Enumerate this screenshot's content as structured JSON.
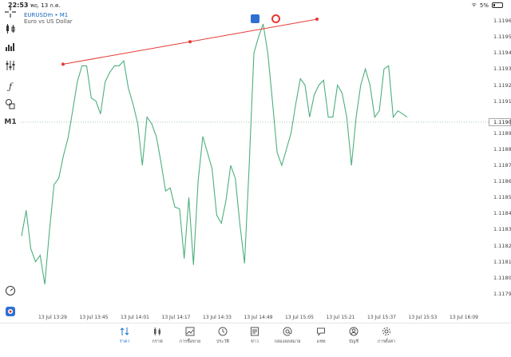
{
  "status": {
    "time": "22:53",
    "date": "พฤ. 13 ก.ค.",
    "battery": "5%"
  },
  "chart": {
    "symbol": "EURUSDm • M1",
    "description": "Euro vs US Dollar",
    "timeframe": "M1",
    "current_price": "1.11900",
    "line_color": "#4caf7d",
    "trendline_color": "#e53935",
    "price_labels": [
      "1.11960",
      "1.11950",
      "1.11940",
      "1.11930",
      "1.11920",
      "1.11910",
      "1.11890",
      "1.11880",
      "1.11870",
      "1.11860",
      "1.11850",
      "1.11840",
      "1.11830",
      "1.11820",
      "1.11810",
      "1.11800",
      "1.11790"
    ],
    "time_labels": [
      "13 Jul 13:29",
      "13 Jul 13:45",
      "13 Jul 14:01",
      "13 Jul 14:17",
      "13 Jul 14:33",
      "13 Jul 14:49",
      "13 Jul 15:05",
      "13 Jul 15:21",
      "13 Jul 15:37",
      "13 Jul 15:53",
      "13 Jul 16:09"
    ]
  },
  "chart_data": {
    "type": "line",
    "series": [
      {
        "values": [
          1.11826,
          1.11842,
          1.11818,
          1.1181,
          1.11814,
          1.11796,
          1.11829,
          1.11858,
          1.11862,
          1.11876,
          1.11887,
          1.11904,
          1.11922,
          1.11932,
          1.11932,
          1.11912,
          1.1191,
          1.11902,
          1.11922,
          1.11928,
          1.11932,
          1.11932,
          1.11935,
          1.11918,
          1.11908,
          1.11896,
          1.1187,
          1.119,
          1.11896,
          1.11888,
          1.11872,
          1.11854,
          1.11856,
          1.11844,
          1.11843,
          1.11812,
          1.1185,
          1.11808,
          1.1186,
          1.11888,
          1.11878,
          1.11868,
          1.11839,
          1.11834,
          1.11848,
          1.1187,
          1.11862,
          1.11833,
          1.11809,
          1.1187,
          1.1194,
          1.1195,
          1.11958,
          1.1194,
          1.1191,
          1.11878,
          1.1187,
          1.1188,
          1.1189,
          1.11908,
          1.11924,
          1.1192,
          1.119,
          1.11914,
          1.1192,
          1.11923,
          1.119,
          1.119,
          1.1192,
          1.11915,
          1.119,
          1.1187,
          1.119,
          1.1192,
          1.1193,
          1.1192,
          1.119,
          1.11904,
          1.1193,
          1.11932,
          1.119,
          1.11904,
          1.11902,
          1.119
        ]
      }
    ],
    "y_unit": "price",
    "ylim": [
      1.11784,
      1.11966
    ],
    "trendline": {
      "from": 1.11933,
      "to": 1.11961
    }
  },
  "tabs": [
    "ราคา",
    "กราฟ",
    "การซื้อขาย",
    "ประวัติ",
    "ข่าว",
    "กล่องจดหมาย",
    "แชท",
    "บัญชี",
    "การตั้งค่า"
  ],
  "active_tab": "ราคา"
}
